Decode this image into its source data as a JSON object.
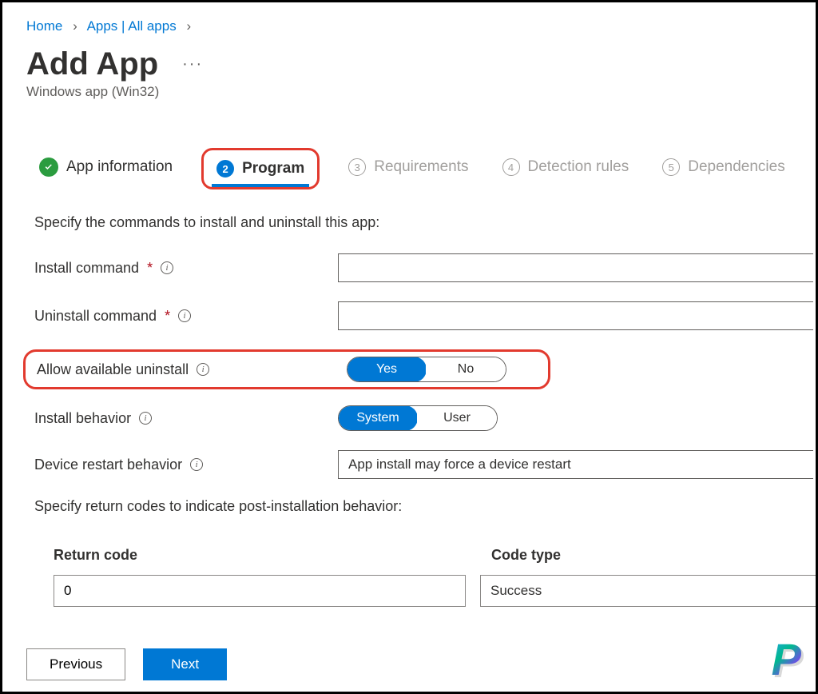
{
  "breadcrumb": {
    "home": "Home",
    "apps": "Apps | All apps"
  },
  "header": {
    "title": "Add App",
    "subtitle": "Windows app (Win32)"
  },
  "tabs": {
    "t1": {
      "label": "App information"
    },
    "t2": {
      "num": "2",
      "label": "Program"
    },
    "t3": {
      "num": "3",
      "label": "Requirements"
    },
    "t4": {
      "num": "4",
      "label": "Detection rules"
    },
    "t5": {
      "num": "5",
      "label": "Dependencies"
    }
  },
  "program": {
    "intro": "Specify the commands to install and uninstall this app:",
    "install_cmd_label": "Install command",
    "install_cmd_value": "",
    "uninstall_cmd_label": "Uninstall command",
    "uninstall_cmd_value": "",
    "allow_uninstall_label": "Allow available uninstall",
    "allow_uninstall_yes": "Yes",
    "allow_uninstall_no": "No",
    "install_behavior_label": "Install behavior",
    "install_behavior_system": "System",
    "install_behavior_user": "User",
    "restart_label": "Device restart behavior",
    "restart_value": "App install may force a device restart",
    "return_codes_intro": "Specify return codes to indicate post-installation behavior:",
    "rc_header_code": "Return code",
    "rc_header_type": "Code type",
    "rc_rows": [
      {
        "code": "0",
        "type": "Success"
      }
    ]
  },
  "buttons": {
    "previous": "Previous",
    "next": "Next"
  },
  "watermark": "P"
}
